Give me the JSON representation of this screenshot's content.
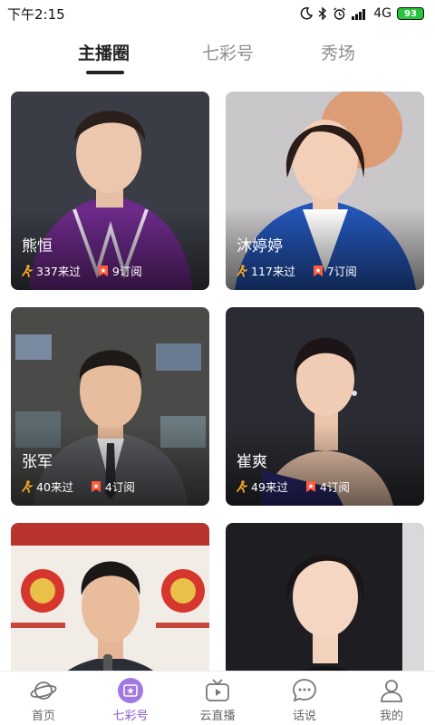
{
  "status": {
    "time": "下午2:15",
    "network": "4G",
    "battery": "93"
  },
  "tabs": [
    {
      "label": "主播圈"
    },
    {
      "label": "七彩号"
    },
    {
      "label": "秀场"
    }
  ],
  "cards": [
    {
      "name": "熊恒",
      "visits": "337来过",
      "subs": "9订阅"
    },
    {
      "name": "沐婷婷",
      "visits": "117来过",
      "subs": "7订阅"
    },
    {
      "name": "张军",
      "visits": "40来过",
      "subs": "4订阅"
    },
    {
      "name": "崔爽",
      "visits": "49来过",
      "subs": "4订阅"
    },
    {
      "name": "",
      "visits": "",
      "subs": ""
    },
    {
      "name": "",
      "visits": "",
      "subs": ""
    }
  ],
  "nav": [
    {
      "label": "首页",
      "icon": "planet-icon"
    },
    {
      "label": "七彩号",
      "icon": "qicaihao-icon"
    },
    {
      "label": "云直播",
      "icon": "tv-icon"
    },
    {
      "label": "话说",
      "icon": "chat-icon"
    },
    {
      "label": "我的",
      "icon": "user-icon"
    }
  ],
  "colors": {
    "accent": "#8a5bd1",
    "battery": "#27c53d",
    "stat_icon": "#f5a623",
    "sub_icon": "#ff5a3c"
  }
}
